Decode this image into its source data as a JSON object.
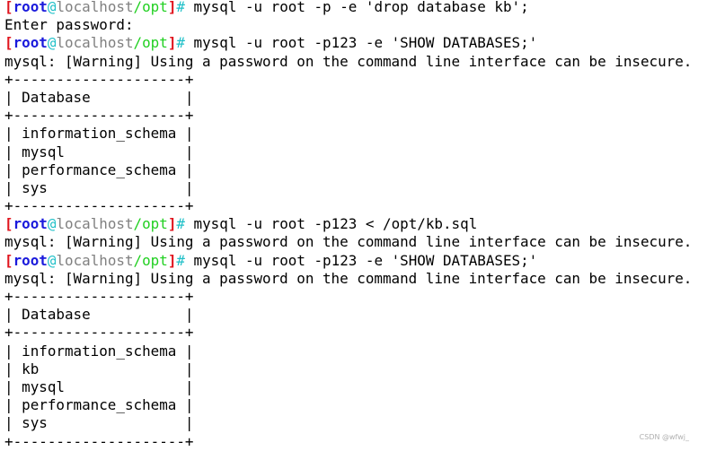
{
  "prompt": {
    "open": "[",
    "user": "root",
    "at": "@",
    "host": "localhost",
    "dir": "/opt",
    "close": "]",
    "hash": "#"
  },
  "colors": {
    "bracket": "#e0141e",
    "user": "#1a1adc",
    "at": "#20c0c8",
    "host": "#808080",
    "dir": "#22d022",
    "hash": "#20c0c8"
  },
  "lines": [
    {
      "type": "prompt",
      "text": " mysql -u root -p -e 'drop database kb';"
    },
    {
      "type": "out",
      "text": "Enter password:"
    },
    {
      "type": "prompt",
      "text": " mysql -u root -p123 -e 'SHOW DATABASES;'"
    },
    {
      "type": "out",
      "text": "mysql: [Warning] Using a password on the command line interface can be insecure."
    },
    {
      "type": "out",
      "text": "+--------------------+"
    },
    {
      "type": "out",
      "text": "| Database           |"
    },
    {
      "type": "out",
      "text": "+--------------------+"
    },
    {
      "type": "out",
      "text": "| information_schema |"
    },
    {
      "type": "out",
      "text": "| mysql              |"
    },
    {
      "type": "out",
      "text": "| performance_schema |"
    },
    {
      "type": "out",
      "text": "| sys                |"
    },
    {
      "type": "out",
      "text": "+--------------------+"
    },
    {
      "type": "prompt",
      "text": " mysql -u root -p123 < /opt/kb.sql"
    },
    {
      "type": "out",
      "text": "mysql: [Warning] Using a password on the command line interface can be insecure."
    },
    {
      "type": "prompt",
      "text": " mysql -u root -p123 -e 'SHOW DATABASES;'"
    },
    {
      "type": "out",
      "text": "mysql: [Warning] Using a password on the command line interface can be insecure."
    },
    {
      "type": "out",
      "text": "+--------------------+"
    },
    {
      "type": "out",
      "text": "| Database           |"
    },
    {
      "type": "out",
      "text": "+--------------------+"
    },
    {
      "type": "out",
      "text": "| information_schema |"
    },
    {
      "type": "out",
      "text": "| kb                 |"
    },
    {
      "type": "out",
      "text": "| mysql              |"
    },
    {
      "type": "out",
      "text": "| performance_schema |"
    },
    {
      "type": "out",
      "text": "| sys                |"
    },
    {
      "type": "out",
      "text": "+--------------------+"
    }
  ],
  "watermark": "CSDN @wfwj_"
}
